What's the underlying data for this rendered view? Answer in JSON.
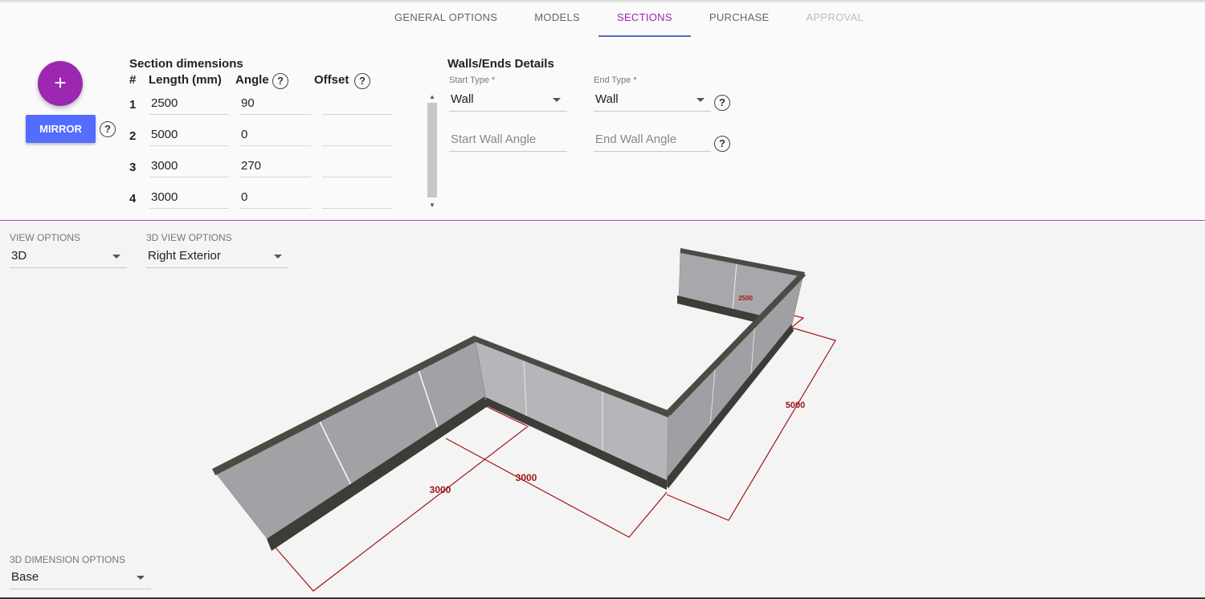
{
  "tabs": [
    {
      "label": "GENERAL OPTIONS",
      "state": "normal"
    },
    {
      "label": "MODELS",
      "state": "normal"
    },
    {
      "label": "SECTIONS",
      "state": "active"
    },
    {
      "label": "PURCHASE",
      "state": "normal"
    },
    {
      "label": "APPROVAL",
      "state": "disabled"
    }
  ],
  "editor": {
    "add_button": "+",
    "mirror_button": "MIRROR",
    "help_glyph": "?",
    "section_title": "Section dimensions",
    "headers": {
      "num": "#",
      "length": "Length (mm)",
      "angle": "Angle",
      "offset": "Offset"
    },
    "rows": [
      {
        "num": "1",
        "length": "2500",
        "angle": "90",
        "offset": ""
      },
      {
        "num": "2",
        "length": "5000",
        "angle": "0",
        "offset": ""
      },
      {
        "num": "3",
        "length": "3000",
        "angle": "270",
        "offset": ""
      },
      {
        "num": "4",
        "length": "3000",
        "angle": "0",
        "offset": ""
      }
    ],
    "walls": {
      "title": "Walls/Ends Details",
      "start_type_label": "Start Type *",
      "start_type_value": "Wall",
      "end_type_label": "End Type *",
      "end_type_value": "Wall",
      "start_wall_angle_placeholder": "Start Wall Angle",
      "end_wall_angle_placeholder": "End Wall Angle"
    }
  },
  "viewer": {
    "view_options_label": "VIEW OPTIONS",
    "view_options_value": "3D",
    "view3d_label": "3D VIEW OPTIONS",
    "view3d_value": "Right Exterior",
    "dim_label": "3D DIMENSION OPTIONS",
    "dim_value": "Base",
    "dimension_labels": {
      "d2500": "2500",
      "d5000": "5000",
      "d3000a": "3000",
      "d3000b": "3000"
    }
  },
  "colors": {
    "accent": "#9c27b0",
    "tab_underline": "#5c6bc0",
    "mirror_button": "#536dfe",
    "dimension": "#a31515"
  }
}
